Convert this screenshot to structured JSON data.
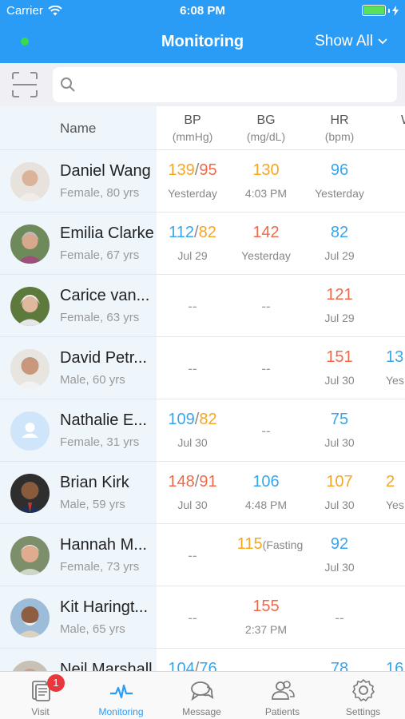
{
  "status_bar": {
    "carrier": "Carrier",
    "time": "6:08 PM"
  },
  "nav": {
    "title": "Monitoring",
    "filter_label": "Show All"
  },
  "search": {
    "placeholder": ""
  },
  "table": {
    "name_header": "Name",
    "columns": [
      {
        "label": "BP",
        "unit": "(mmHg)"
      },
      {
        "label": "BG",
        "unit": "(mg/dL)"
      },
      {
        "label": "HR",
        "unit": "(bpm)"
      },
      {
        "label": "W",
        "unit": ""
      }
    ],
    "rows": [
      {
        "name": "Daniel Wang",
        "info": "Female, 80 yrs",
        "bp": {
          "sys": "139",
          "sep": "/",
          "dia": "95",
          "date": "Yesterday"
        },
        "bg": {
          "value": "130",
          "date": "4:03 PM"
        },
        "hr": {
          "value": "96",
          "date": "Yesterday"
        },
        "w": {
          "value": "",
          "date": ""
        }
      },
      {
        "name": "Emilia Clarke",
        "info": "Female, 67 yrs",
        "bp": {
          "sys": "112",
          "sep": "/",
          "dia": "82",
          "date": "Jul 29"
        },
        "bg": {
          "value": "142",
          "date": "Yesterday"
        },
        "hr": {
          "value": "82",
          "date": "Jul 29"
        },
        "w": {
          "value": "",
          "date": ""
        }
      },
      {
        "name": "Carice van...",
        "info": "Female, 63 yrs",
        "bp": {
          "dash": "--"
        },
        "bg": {
          "dash": "--"
        },
        "hr": {
          "value": "121",
          "date": "Jul 29"
        },
        "w": {
          "value": "",
          "date": ""
        }
      },
      {
        "name": "David Petr...",
        "info": "Male, 60 yrs",
        "bp": {
          "dash": "--"
        },
        "bg": {
          "dash": "--"
        },
        "hr": {
          "value": "151",
          "date": "Jul 30"
        },
        "w": {
          "value": "13",
          "date": "Yes"
        }
      },
      {
        "name": "Nathalie E...",
        "info": "Female, 31 yrs",
        "bp": {
          "sys": "109",
          "sep": "/",
          "dia": "82",
          "date": "Jul 30"
        },
        "bg": {
          "dash": "--"
        },
        "hr": {
          "value": "75",
          "date": "Jul 30"
        },
        "w": {
          "value": "",
          "date": ""
        }
      },
      {
        "name": "Brian Kirk",
        "info": "Male, 59 yrs",
        "bp": {
          "sys": "148",
          "sep": "/",
          "dia": "91",
          "date": "Jul 30"
        },
        "bg": {
          "value": "106",
          "date": "4:48 PM"
        },
        "hr": {
          "value": "107",
          "date": "Jul 30"
        },
        "w": {
          "value": "2",
          "date": "Yes"
        }
      },
      {
        "name": "Hannah M...",
        "info": "Female, 73 yrs",
        "bp": {
          "dash": "--"
        },
        "bg": {
          "value": "115",
          "note": "(Fasting"
        },
        "hr": {
          "value": "92",
          "date": "Jul 30"
        },
        "w": {
          "value": "",
          "date": ""
        }
      },
      {
        "name": "Kit Haringt...",
        "info": "Male, 65 yrs",
        "bp": {
          "dash": "--"
        },
        "bg": {
          "value": "155",
          "date": "2:37 PM"
        },
        "hr": {
          "dash": "--"
        },
        "w": {
          "value": "",
          "date": ""
        }
      },
      {
        "name": "Neil Marshall",
        "info": "",
        "bp": {
          "sys": "104",
          "sep": "/",
          "dia": "76",
          "date": ""
        },
        "bg": {
          "value": "",
          "date": ""
        },
        "hr": {
          "value": "78",
          "date": ""
        },
        "w": {
          "value": "16",
          "date": ""
        }
      }
    ]
  },
  "tabbar": {
    "visit": "Visit",
    "visit_badge": "1",
    "monitoring": "Monitoring",
    "message": "Message",
    "patients": "Patients",
    "settings": "Settings"
  },
  "colors": {
    "accent": "#2b9cf6",
    "orange": "#f5a623",
    "red": "#ef6a4a",
    "blue": "#39a6ea",
    "online": "#38d94a"
  },
  "icons": [
    "wifi-icon",
    "battery-icon",
    "chevron-down-icon",
    "scan-icon",
    "search-icon",
    "visit-icon",
    "monitoring-icon",
    "message-icon",
    "patients-icon",
    "settings-icon"
  ]
}
